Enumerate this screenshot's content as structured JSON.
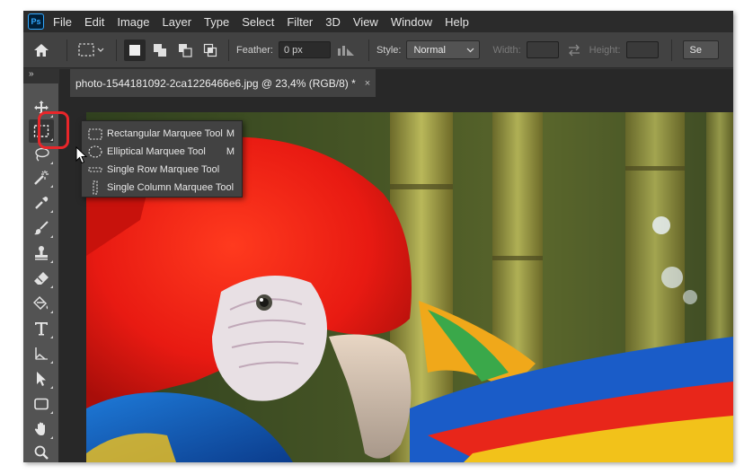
{
  "app": {
    "logo_text": "Ps"
  },
  "menu": [
    "File",
    "Edit",
    "Image",
    "Layer",
    "Type",
    "Select",
    "Filter",
    "3D",
    "View",
    "Window",
    "Help"
  ],
  "options": {
    "feather_label": "Feather:",
    "feather_value": "0 px",
    "style_label": "Style:",
    "style_value": "Normal",
    "width_label": "Width:",
    "height_label": "Height:",
    "select_mask_partial": "Se"
  },
  "panel_collapse": "»",
  "document": {
    "tab_title": "photo-1544181092-2ca1226466e6.jpg @ 23,4% (RGB/8) *",
    "close_glyph": "×"
  },
  "tools": [
    "move-icon",
    "rectangular-marquee-icon",
    "lasso-icon",
    "magic-wand-icon",
    "eyedropper-icon",
    "brush-icon",
    "clone-stamp-icon",
    "eraser-icon",
    "paint-bucket-icon",
    "type-icon",
    "path-selection-icon",
    "direct-selection-icon",
    "rectangle-icon",
    "hand-icon",
    "zoom-icon"
  ],
  "flyout": [
    {
      "label": "Rectangular Marquee Tool",
      "shortcut": "M"
    },
    {
      "label": "Elliptical Marquee Tool",
      "shortcut": "M"
    },
    {
      "label": "Single Row Marquee Tool",
      "shortcut": ""
    },
    {
      "label": "Single Column Marquee Tool",
      "shortcut": ""
    }
  ],
  "colors": {
    "highlight_ring": "#e8262a",
    "ps_blue": "#31a8ff",
    "panel": "#535353",
    "options_bar": "#424242",
    "menubar": "#2b2b2b"
  }
}
